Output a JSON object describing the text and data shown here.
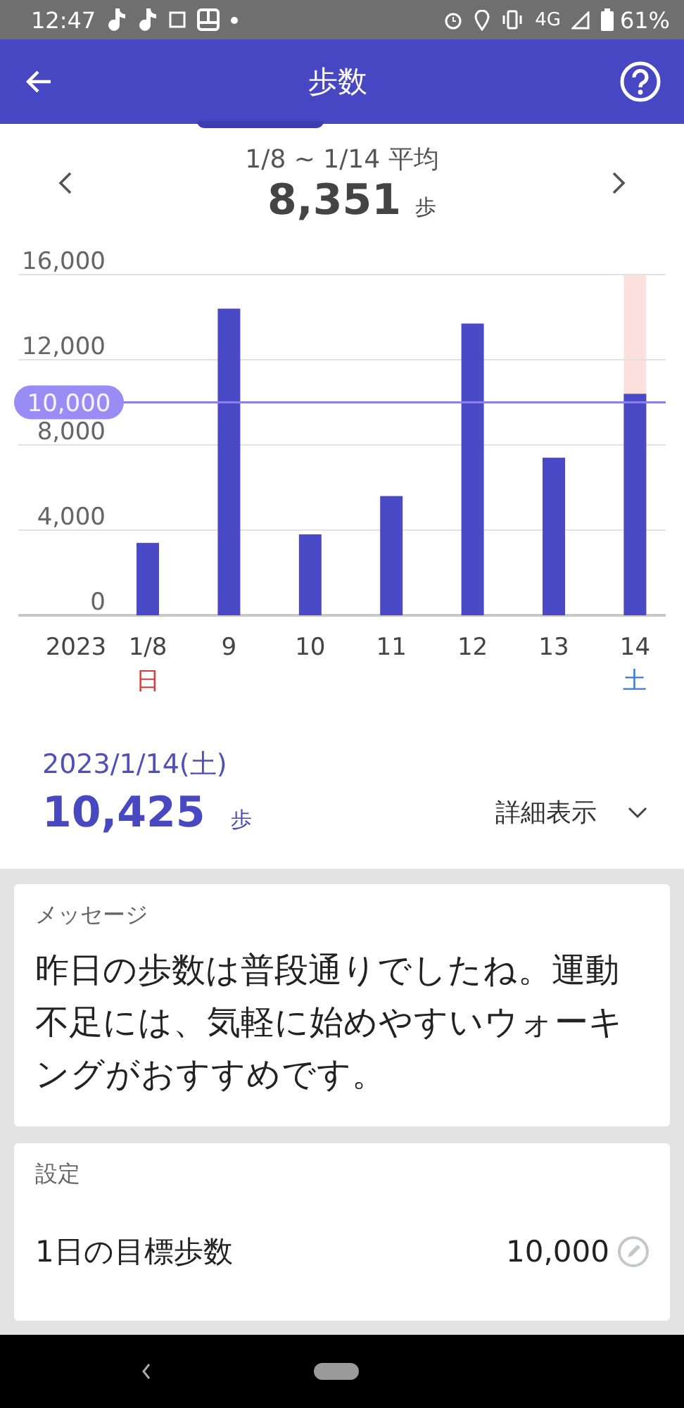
{
  "status_bar": {
    "time": "12:47",
    "network": "4G",
    "battery": "61%"
  },
  "app_bar": {
    "title": "歩数"
  },
  "week": {
    "range": "1/8 ~ 1/14 平均",
    "average": "8,351",
    "unit": "歩"
  },
  "chart_data": {
    "type": "bar",
    "categories": [
      "1/8",
      "9",
      "10",
      "11",
      "12",
      "13",
      "14"
    ],
    "values": [
      3400,
      14400,
      3800,
      5600,
      13700,
      7400,
      10400
    ],
    "ylim": [
      0,
      16000
    ],
    "yticks": [
      {
        "value": 0,
        "label": "0"
      },
      {
        "value": 4000,
        "label": "4,000"
      },
      {
        "value": 8000,
        "label": "8,000"
      },
      {
        "value": 12000,
        "label": "12,000"
      },
      {
        "value": 16000,
        "label": "16,000"
      }
    ],
    "grid": true,
    "ref_lines": [
      {
        "axis": "y",
        "value": 10000,
        "label": "10,000"
      }
    ]
  },
  "chart_labels": {
    "year": "2023",
    "days": [
      {
        "weekday": "日",
        "color": "#d23c3c",
        "selected": false
      },
      {
        "selected": false
      },
      {
        "selected": false
      },
      {
        "selected": false
      },
      {
        "selected": false
      },
      {
        "selected": false
      },
      {
        "weekday": "土",
        "color": "#3c7fd2",
        "selected": true
      }
    ]
  },
  "day": {
    "date": "2023/1/14(土)",
    "steps": "10,425",
    "unit": "歩",
    "details_label": "詳細表示",
    "expanded": false
  },
  "message": {
    "title": "メッセージ",
    "text": "昨日の歩数は普段通りでしたね。運動不足には、気軽に始めやすいウォーキングがおすすめです。"
  },
  "settings": {
    "title": "設定",
    "items": [
      {
        "label": "1日の目標歩数",
        "value": "10,000"
      }
    ]
  }
}
